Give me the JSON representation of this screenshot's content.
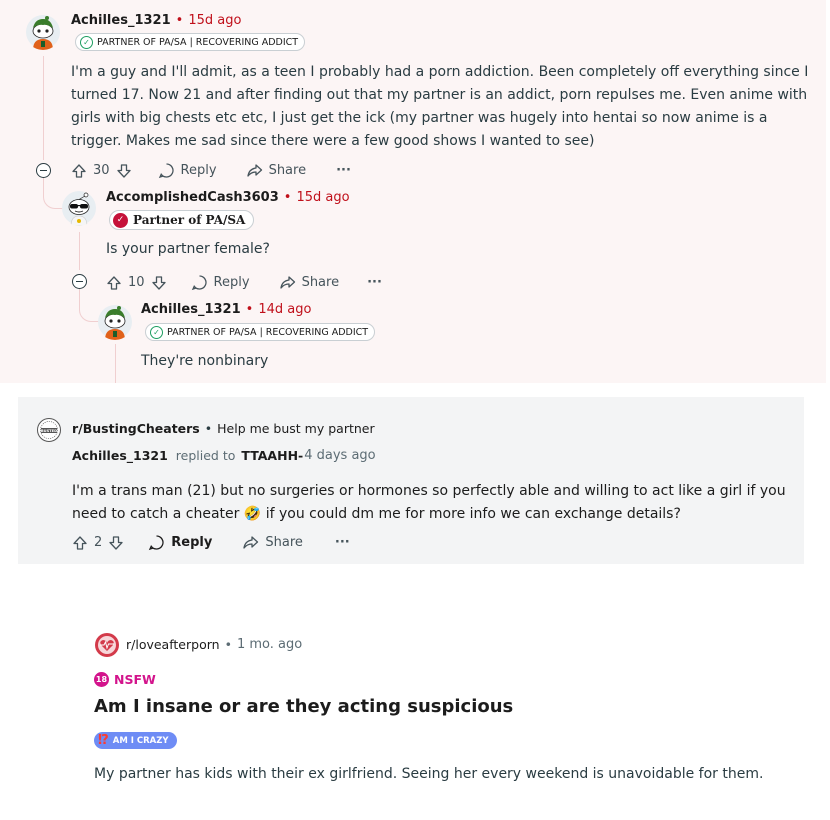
{
  "comment1": {
    "user": "Achilles_1321",
    "time": "15d ago",
    "flair": "PARTNER OF PA/SA | RECOVERING ADDICT",
    "body": "I'm a guy and I'll admit, as a teen I probably had a porn addiction. Been completely off everything since I turned 17. Now 21 and after finding out that my partner is an addict, porn repulses me. Even anime with girls with big chests etc etc, I just get the ick (my partner was hugely into hentai so now anime is a trigger. Makes me sad since there were a few good shows I wanted to see)",
    "votes": "30",
    "reply": "Reply",
    "share": "Share",
    "more": "···"
  },
  "comment2": {
    "user": "AccomplishedCash3603",
    "time": "15d ago",
    "flair": "Partner of PA/SA",
    "body": "Is your partner female?",
    "votes": "10",
    "reply": "Reply",
    "share": "Share",
    "more": "···"
  },
  "comment3": {
    "user": "Achilles_1321",
    "time": "14d ago",
    "flair": "PARTNER OF PA/SA | RECOVERING ADDICT",
    "body": "They're nonbinary"
  },
  "search_result": {
    "subreddit": "r/BustingCheaters",
    "post_title": "Help me bust my partner",
    "user": "Achilles_1321",
    "replied_to_label": "replied to",
    "replied_to": "TTAAHH-",
    "time": "4 days ago",
    "body_part1": "I'm a trans man (21) but no surgeries or hormones so perfectly able and willing to act like a girl if you need to catch a cheater",
    "emoji": "🤣",
    "body_part2": "if you could dm me for more info we can exchange details?",
    "votes": "2",
    "reply": "Reply",
    "share": "Share",
    "more": "···"
  },
  "post": {
    "subreddit": "r/loveafterporn",
    "time": "1 mo. ago",
    "nsfw_badge": "18",
    "nsfw_label": "NSFW",
    "title": "Am I insane or are they acting suspicious",
    "flair_icon": "⁉",
    "flair": "AM I CRAZY",
    "body": "My partner has kids with their ex girlfriend. Seeing her every weekend is unavoidable for them."
  },
  "colors": {
    "time_red": "#c0101b",
    "panel_pink": "#fcf5f5",
    "panel_gray": "#f3f4f5",
    "nsfw_pink": "#d3148c",
    "flair_blue": "#6e8cf5"
  }
}
